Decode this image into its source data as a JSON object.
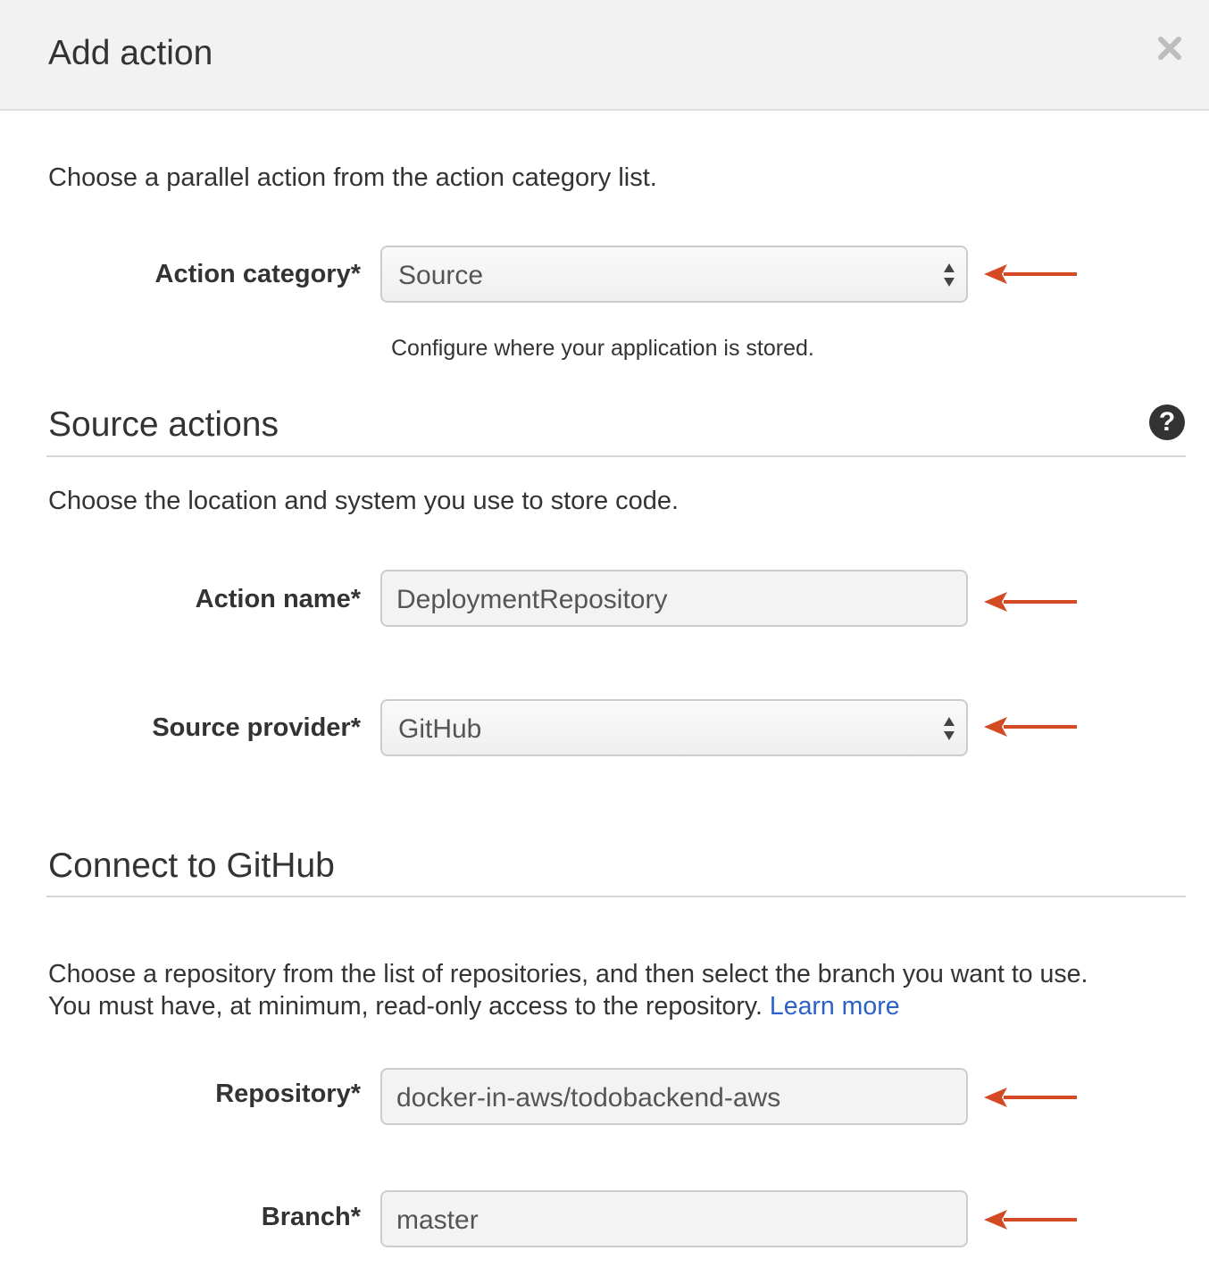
{
  "dialog": {
    "title": "Add action",
    "intro": "Choose a parallel action from the action category list."
  },
  "action_category": {
    "label": "Action category*",
    "value": "Source",
    "hint": "Configure where your application is stored."
  },
  "source_actions": {
    "title": "Source actions",
    "description": "Choose the location and system you use to store code.",
    "action_name": {
      "label": "Action name*",
      "value": "DeploymentRepository"
    },
    "source_provider": {
      "label": "Source provider*",
      "value": "GitHub"
    }
  },
  "connect_github": {
    "title": "Connect to GitHub",
    "description_line1": "Choose a repository from the list of repositories, and then select the branch you want to use.",
    "description_line2": "You must have, at minimum, read-only access to the repository.",
    "learn_more": "Learn more",
    "repository": {
      "label": "Repository*",
      "value": "docker-in-aws/todobackend-aws"
    },
    "branch": {
      "label": "Branch*",
      "value": "master"
    }
  },
  "colors": {
    "annotation_arrow": "#d34a24",
    "link": "#2a62c9",
    "header_bg": "#f2f2f2"
  },
  "icons": [
    "close-icon",
    "help-icon",
    "select-caret-icon",
    "annotation-arrow-icon"
  ]
}
